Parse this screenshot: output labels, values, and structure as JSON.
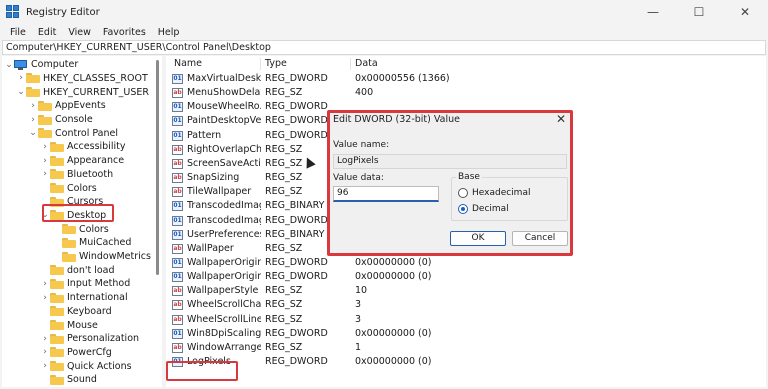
{
  "window": {
    "title": "Registry Editor",
    "controls": {
      "minimize": "—",
      "maximize": "☐",
      "close": "✕"
    }
  },
  "menu": [
    "File",
    "Edit",
    "View",
    "Favorites",
    "Help"
  ],
  "address": "Computer\\HKEY_CURRENT_USER\\Control Panel\\Desktop",
  "tree": [
    {
      "label": "Computer",
      "chev": "⌄"
    },
    {
      "label": "HKEY_CLASSES_ROOT",
      "chev": "›"
    },
    {
      "label": "HKEY_CURRENT_USER",
      "chev": "⌄"
    },
    {
      "label": "AppEvents",
      "chev": "›"
    },
    {
      "label": "Console",
      "chev": "›"
    },
    {
      "label": "Control Panel",
      "chev": "⌄"
    },
    {
      "label": "Accessibility",
      "chev": "›"
    },
    {
      "label": "Appearance",
      "chev": "›"
    },
    {
      "label": "Bluetooth",
      "chev": "›"
    },
    {
      "label": "Colors",
      "chev": ""
    },
    {
      "label": "Cursors",
      "chev": ""
    },
    {
      "label": "Desktop",
      "chev": "⌄"
    },
    {
      "label": "Colors",
      "chev": ""
    },
    {
      "label": "MuiCached",
      "chev": ""
    },
    {
      "label": "WindowMetrics",
      "chev": ""
    },
    {
      "label": "don't load",
      "chev": ""
    },
    {
      "label": "Input Method",
      "chev": "›"
    },
    {
      "label": "International",
      "chev": "›"
    },
    {
      "label": "Keyboard",
      "chev": ""
    },
    {
      "label": "Mouse",
      "chev": ""
    },
    {
      "label": "Personalization",
      "chev": "›"
    },
    {
      "label": "PowerCfg",
      "chev": "›"
    },
    {
      "label": "Quick Actions",
      "chev": "›"
    },
    {
      "label": "Sound",
      "chev": ""
    }
  ],
  "list": {
    "headers": {
      "name": "Name",
      "type": "Type",
      "data": "Data"
    },
    "rows": [
      {
        "name": "MaxVirtualDeskt...",
        "type": "REG_DWORD",
        "data": "0x00000556 (1366)",
        "kind": "bin"
      },
      {
        "name": "MenuShowDelay",
        "type": "REG_SZ",
        "data": "400",
        "kind": "sz"
      },
      {
        "name": "MouseWheelRo...",
        "type": "REG_DWORD",
        "data": "",
        "kind": "bin"
      },
      {
        "name": "PaintDesktopVer...",
        "type": "REG_DWORD",
        "data": "",
        "kind": "bin"
      },
      {
        "name": "Pattern",
        "type": "REG_DWORD",
        "data": "",
        "kind": "bin"
      },
      {
        "name": "RightOverlapCh...",
        "type": "REG_SZ",
        "data": "",
        "kind": "sz"
      },
      {
        "name": "ScreenSaveActive",
        "type": "REG_SZ",
        "data": "",
        "kind": "sz"
      },
      {
        "name": "SnapSizing",
        "type": "REG_SZ",
        "data": "",
        "kind": "sz"
      },
      {
        "name": "TileWallpaper",
        "type": "REG_SZ",
        "data": "",
        "kind": "sz"
      },
      {
        "name": "TranscodedImag...",
        "type": "REG_BINARY",
        "data": "",
        "kind": "bin"
      },
      {
        "name": "TranscodedImag...",
        "type": "REG_DWORD",
        "data": "",
        "kind": "bin"
      },
      {
        "name": "UserPreferences...",
        "type": "REG_BINARY",
        "data": "",
        "kind": "bin"
      },
      {
        "name": "WallPaper",
        "type": "REG_SZ",
        "data": "",
        "kind": "sz"
      },
      {
        "name": "WallpaperOriginX",
        "type": "REG_DWORD",
        "data": "0x00000000 (0)",
        "kind": "bin"
      },
      {
        "name": "WallpaperOriginY",
        "type": "REG_DWORD",
        "data": "0x00000000 (0)",
        "kind": "bin"
      },
      {
        "name": "WallpaperStyle",
        "type": "REG_SZ",
        "data": "10",
        "kind": "sz"
      },
      {
        "name": "WheelScrollChars",
        "type": "REG_SZ",
        "data": "3",
        "kind": "sz"
      },
      {
        "name": "WheelScrollLines",
        "type": "REG_SZ",
        "data": "3",
        "kind": "sz"
      },
      {
        "name": "Win8DpiScaling",
        "type": "REG_DWORD",
        "data": "0x00000000 (0)",
        "kind": "bin"
      },
      {
        "name": "WindowArrange...",
        "type": "REG_SZ",
        "data": "1",
        "kind": "sz"
      },
      {
        "name": "LogPixels",
        "type": "REG_DWORD",
        "data": "0x00000000 (0)",
        "kind": "bin"
      }
    ]
  },
  "dialog": {
    "title": "Edit DWORD (32-bit) Value",
    "close": "✕",
    "value_name_label": "Value name:",
    "value_name": "LogPixels",
    "value_data_label": "Value data:",
    "value_data": "96",
    "base_label": "Base",
    "hex_label": "Hexadecimal",
    "dec_label": "Decimal",
    "ok": "OK",
    "cancel": "Cancel"
  },
  "colors": {
    "highlight": "#d9383c",
    "accent": "#1f5fb5"
  }
}
